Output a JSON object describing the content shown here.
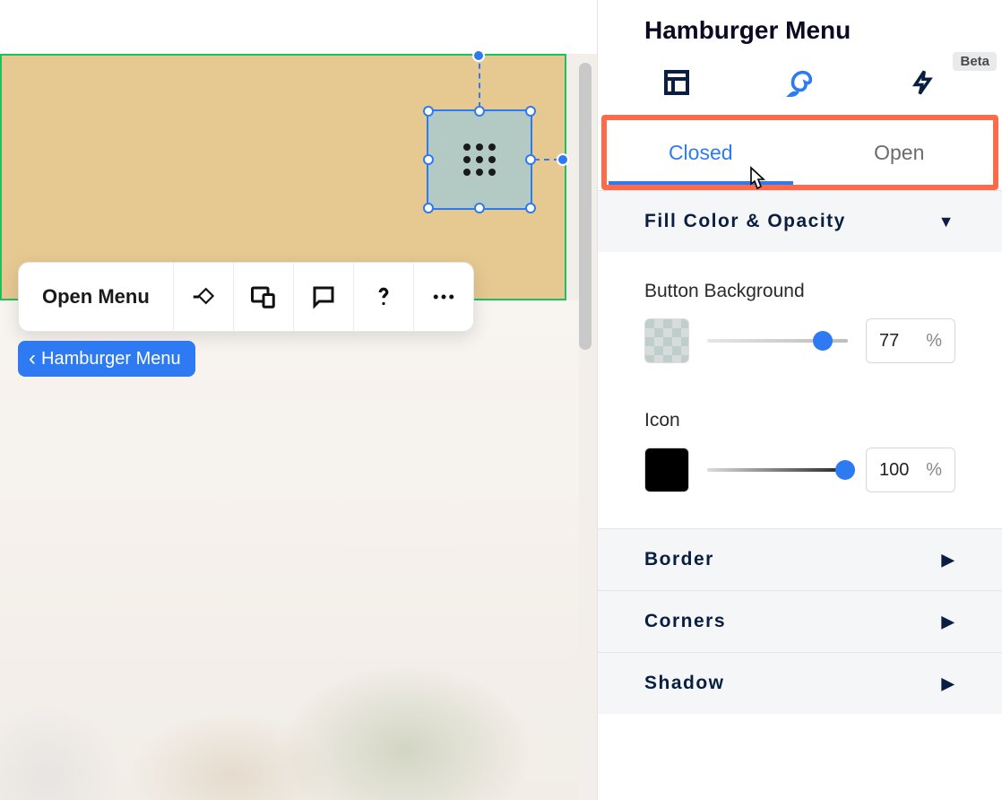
{
  "panel": {
    "title": "Hamburger Menu",
    "beta_label": "Beta",
    "tabs": {
      "layout": "layout",
      "design": "design",
      "effects": "effects"
    },
    "state_tabs": {
      "closed": "Closed",
      "open": "Open",
      "active": "closed"
    }
  },
  "sections": {
    "fill": {
      "title": "Fill Color & Opacity",
      "button_bg_label": "Button Background",
      "button_bg_opacity": "77",
      "icon_label": "Icon",
      "icon_opacity": "100",
      "percent_unit": "%"
    },
    "border": {
      "title": "Border"
    },
    "corners": {
      "title": "Corners"
    },
    "shadow": {
      "title": "Shadow"
    }
  },
  "canvas": {
    "toolbar": {
      "open_menu": "Open Menu"
    },
    "breadcrumb": "Hamburger Menu"
  }
}
